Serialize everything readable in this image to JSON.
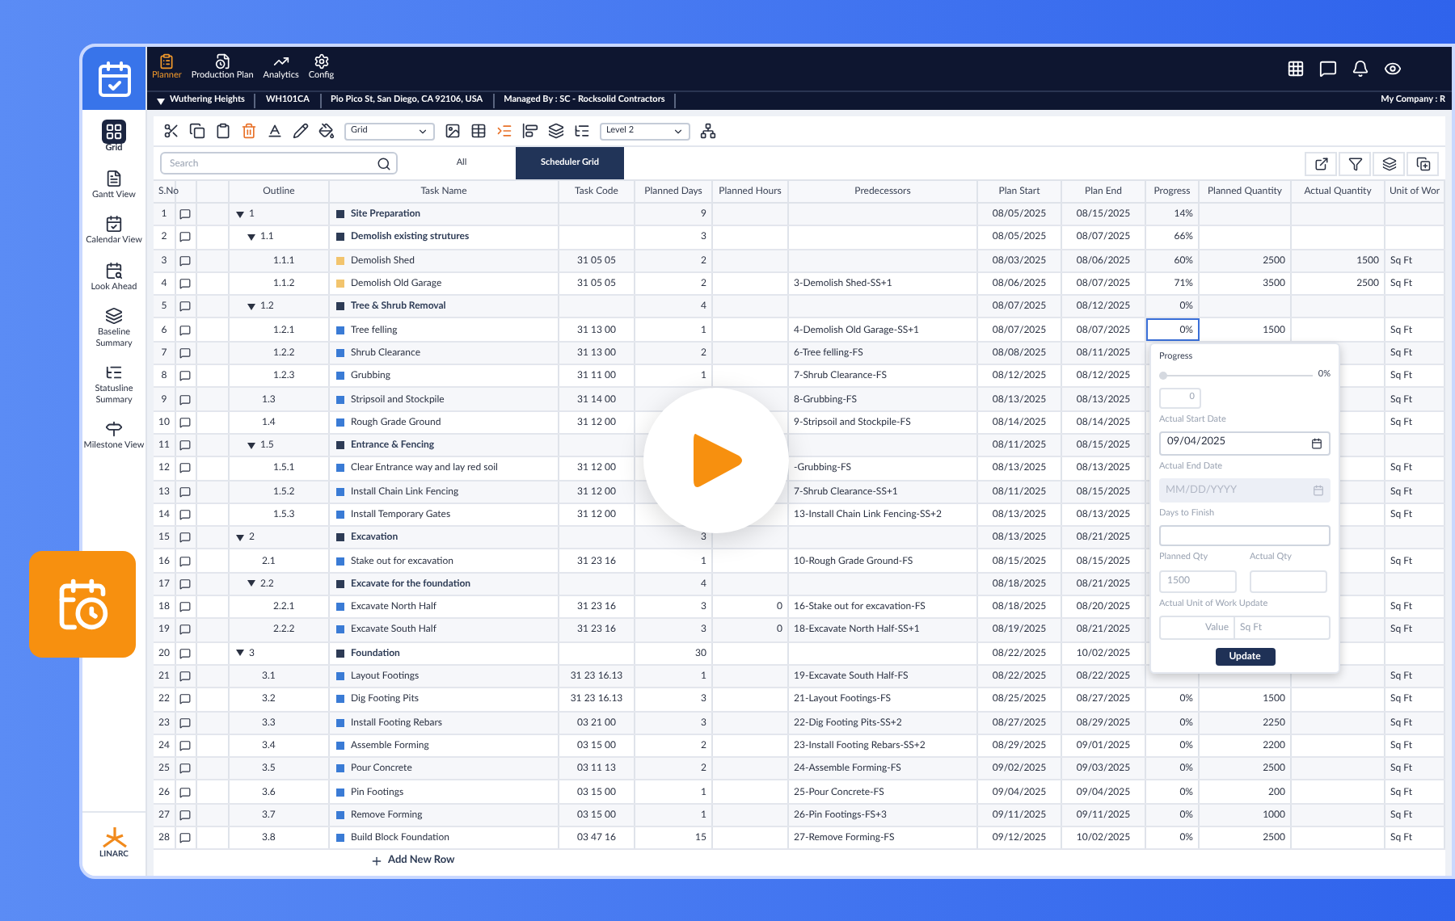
{
  "nav": {
    "tabs": [
      {
        "label": "Planner",
        "selected": true
      },
      {
        "label": "Production Plan",
        "selected": false
      },
      {
        "label": "Analytics",
        "selected": false
      },
      {
        "label": "Config",
        "selected": false
      }
    ]
  },
  "project_bar": {
    "project": "Wuthering Heights",
    "code": "WH101CA",
    "address": "Pio Pico St, San Diego, CA 92106, USA",
    "manager": "Managed By : SC - Rocksolid Contractors",
    "company": "My Company : R"
  },
  "sidebar": {
    "items": [
      {
        "label": "Grid",
        "selected": true
      },
      {
        "label": "Gantt View",
        "selected": false
      },
      {
        "label": "Calendar View",
        "selected": false
      },
      {
        "label": "Look Ahead",
        "selected": false
      },
      {
        "label": "Baseline Summary",
        "selected": false
      },
      {
        "label": "Statusline Summary",
        "selected": false
      },
      {
        "label": "Milestone View",
        "selected": false
      }
    ],
    "logo": "LINARC"
  },
  "toolbar": {
    "view_select": "Grid",
    "level_select": "Level 2"
  },
  "search": {
    "placeholder": "Search"
  },
  "tabs": [
    {
      "label": "All",
      "selected": false
    },
    {
      "label": "Scheduler Grid",
      "selected": true
    }
  ],
  "table": {
    "columns": [
      "S.No",
      "Outline",
      "Task Name",
      "Task Code",
      "Planned Days",
      "Planned Hours",
      "Predecessors",
      "Plan Start",
      "Plan End",
      "Progress",
      "Planned Quantity",
      "Actual Quantity",
      "Unit of Wor"
    ],
    "rows": [
      {
        "sno": "1",
        "outline": "1",
        "name": "Site Preparation",
        "color": "#2d3b55",
        "days": "9",
        "start": "08/05/2025",
        "end": "08/15/2025",
        "progress": "14%",
        "selected": false,
        "expanded": true,
        "children": [
          {
            "sno": "2",
            "outline": "1.1",
            "name": "Demolish existing strutures",
            "color": "#2d3b55",
            "days": "3",
            "start": "08/05/2025",
            "end": "08/07/2025",
            "progress": "66%",
            "selected": false,
            "expanded": true,
            "children": [
              {
                "sno": "3",
                "outline": "1.1.1",
                "name": "Demolish Shed",
                "color": "#f2c46d",
                "code": "31 05 05",
                "days": "2",
                "start": "08/03/2025",
                "end": "08/06/2025",
                "progress": "60%",
                "pqty": "2500",
                "aqty": "1500",
                "unit": "Sq Ft",
                "selected": false
              },
              {
                "sno": "4",
                "outline": "1.1.2",
                "name": "Demolish Old Garage",
                "color": "#f2c46d",
                "code": "31 05 05",
                "days": "2",
                "pred": "3-Demolish Shed-SS+1",
                "start": "08/06/2025",
                "end": "08/07/2025",
                "progress": "71%",
                "pqty": "3500",
                "aqty": "2500",
                "unit": "Sq Ft",
                "selected": false
              }
            ]
          },
          {
            "sno": "5",
            "outline": "1.2",
            "name": "Tree & Shrub Removal",
            "color": "#2d3b55",
            "days": "4",
            "start": "08/07/2025",
            "end": "08/12/2025",
            "progress": "0%",
            "selected": false,
            "expanded": true,
            "children": [
              {
                "sno": "6",
                "outline": "1.2.1",
                "name": "Tree felling",
                "color": "#3a7bd5",
                "code": "31 13 00",
                "days": "1",
                "pred": "4-Demolish Old Garage-SS+1",
                "start": "08/07/2025",
                "end": "08/07/2025",
                "progress": "0%",
                "pqty": "1500",
                "unit": "Sq Ft",
                "selected": true
              },
              {
                "sno": "7",
                "outline": "1.2.2",
                "name": "Shrub Clearance",
                "color": "#3a7bd5",
                "code": "31 13 00",
                "days": "2",
                "pred": "6-Tree felling-FS",
                "start": "08/08/2025",
                "end": "08/11/2025",
                "unit": "Sq Ft",
                "selected": false
              },
              {
                "sno": "8",
                "outline": "1.2.3",
                "name": "Grubbing",
                "color": "#3a7bd5",
                "code": "31 11 00",
                "days": "1",
                "pred": "7-Shrub Clearance-FS",
                "start": "08/12/2025",
                "end": "08/12/2025",
                "unit": "Sq Ft",
                "selected": false
              }
            ]
          },
          {
            "sno": "9",
            "outline": "1.3",
            "name": "Stripsoil and Stockpile",
            "color": "#3a7bd5",
            "code": "31 14 00",
            "pred": "8-Grubbing-FS",
            "start": "08/13/2025",
            "end": "08/13/2025",
            "unit": "Sq Ft",
            "selected": false
          },
          {
            "sno": "10",
            "outline": "1.4",
            "name": "Rough Grade Ground",
            "color": "#3a7bd5",
            "code": "31 12 00",
            "pred": "9-Stripsoil and Stockpile-FS",
            "start": "08/14/2025",
            "end": "08/14/2025",
            "unit": "Sq Ft",
            "selected": false
          },
          {
            "sno": "11",
            "outline": "1.5",
            "name": "Entrance & Fencing",
            "color": "#2d3b55",
            "start": "08/11/2025",
            "end": "08/15/2025",
            "selected": false,
            "expanded": true,
            "children": [
              {
                "sno": "12",
                "outline": "1.5.1",
                "name": "Clear Entrance way and lay red soil",
                "color": "#3a7bd5",
                "code": "31 12 00",
                "pred": "-Grubbing-FS",
                "start": "08/13/2025",
                "end": "08/13/2025",
                "unit": "Sq Ft",
                "selected": false
              },
              {
                "sno": "13",
                "outline": "1.5.2",
                "name": "Install Chain Link Fencing",
                "color": "#3a7bd5",
                "code": "31 12 00",
                "pred": "7-Shrub Clearance-SS+1",
                "start": "08/11/2025",
                "end": "08/15/2025",
                "unit": "Sq Ft",
                "selected": false
              },
              {
                "sno": "14",
                "outline": "1.5.3",
                "name": "Install Temporary Gates",
                "color": "#3a7bd5",
                "code": "31 12 00",
                "pred": "13-Install Chain Link Fencing-SS+2",
                "start": "08/13/2025",
                "end": "08/13/2025",
                "unit": "Sq Ft",
                "selected": false
              }
            ]
          }
        ]
      },
      {
        "sno": "15",
        "outline": "2",
        "name": "Excavation",
        "color": "#2d3b55",
        "days": "3",
        "start": "08/13/2025",
        "end": "08/21/2025",
        "selected": false,
        "expanded": true,
        "children": [
          {
            "sno": "16",
            "outline": "2.1",
            "name": "Stake out for excavation",
            "color": "#3a7bd5",
            "code": "31 23 16",
            "days": "1",
            "pred": "10-Rough Grade Ground-FS",
            "start": "08/15/2025",
            "end": "08/15/2025",
            "unit": "Sq Ft",
            "selected": false
          },
          {
            "sno": "17",
            "outline": "2.2",
            "name": "Excavate for the foundation",
            "color": "#2d3b55",
            "days": "4",
            "start": "08/18/2025",
            "end": "08/21/2025",
            "selected": false,
            "expanded": true,
            "children": [
              {
                "sno": "18",
                "outline": "2.2.1",
                "name": "Excavate North Half",
                "color": "#3a7bd5",
                "code": "31 23 16",
                "days": "3",
                "hours": "0",
                "pred": "16-Stake out for excavation-FS",
                "start": "08/18/2025",
                "end": "08/20/2025",
                "unit": "Sq Ft",
                "selected": false
              },
              {
                "sno": "19",
                "outline": "2.2.2",
                "name": "Excavate South Half",
                "color": "#3a7bd5",
                "code": "31 23 16",
                "days": "3",
                "hours": "0",
                "pred": "18-Excavate North Half-SS+1",
                "start": "08/19/2025",
                "end": "08/21/2025",
                "unit": "Sq Ft",
                "selected": false
              }
            ]
          }
        ]
      },
      {
        "sno": "20",
        "outline": "3",
        "name": "Foundation",
        "color": "#2d3b55",
        "days": "30",
        "start": "08/22/2025",
        "end": "10/02/2025",
        "selected": false,
        "expanded": true,
        "children": [
          {
            "sno": "21",
            "outline": "3.1",
            "name": "Layout Footings",
            "color": "#3a7bd5",
            "code": "31 23 16.13",
            "days": "1",
            "pred": "19-Excavate South Half-FS",
            "start": "08/22/2025",
            "end": "08/22/2025",
            "unit": "Sq Ft",
            "selected": false
          },
          {
            "sno": "22",
            "outline": "3.2",
            "name": "Dig Footing Pits",
            "color": "#3a7bd5",
            "code": "31 23 16.13",
            "days": "3",
            "pred": "21-Layout Footings-FS",
            "start": "08/25/2025",
            "end": "08/27/2025",
            "progress": "0%",
            "pqty": "1500",
            "unit": "Sq Ft",
            "selected": false
          },
          {
            "sno": "23",
            "outline": "3.3",
            "name": "Install Footing Rebars",
            "color": "#3a7bd5",
            "code": "03 21 00",
            "days": "3",
            "pred": "22-Dig Footing Pits-SS+2",
            "start": "08/27/2025",
            "end": "08/29/2025",
            "progress": "0%",
            "pqty": "2250",
            "unit": "Sq Ft",
            "selected": false
          },
          {
            "sno": "24",
            "outline": "3.4",
            "name": "Assemble Forming",
            "color": "#3a7bd5",
            "code": "03 15 00",
            "days": "2",
            "pred": "23-Install Footing Rebars-SS+2",
            "start": "08/29/2025",
            "end": "09/01/2025",
            "progress": "0%",
            "pqty": "2200",
            "unit": "Sq Ft",
            "selected": false
          },
          {
            "sno": "25",
            "outline": "3.5",
            "name": "Pour Concrete",
            "color": "#3a7bd5",
            "code": "03 11 13",
            "days": "2",
            "pred": "24-Assemble Forming-FS",
            "start": "09/02/2025",
            "end": "09/03/2025",
            "progress": "0%",
            "pqty": "2500",
            "unit": "Sq Ft",
            "selected": false
          },
          {
            "sno": "26",
            "outline": "3.6",
            "name": "Pin Footings",
            "color": "#3a7bd5",
            "code": "03 15 00",
            "days": "1",
            "pred": "25-Pour Concrete-FS",
            "start": "09/04/2025",
            "end": "09/04/2025",
            "progress": "0%",
            "pqty": "200",
            "unit": "Sq Ft",
            "selected": false
          },
          {
            "sno": "27",
            "outline": "3.7",
            "name": "Remove Forming",
            "color": "#3a7bd5",
            "code": "03 15 00",
            "days": "1",
            "pred": "26-Pin Footings-FS+3",
            "start": "09/11/2025",
            "end": "09/11/2025",
            "progress": "0%",
            "pqty": "1000",
            "unit": "Sq Ft",
            "selected": false
          },
          {
            "sno": "28",
            "outline": "3.8",
            "name": "Build Block Foundation",
            "color": "#3a7bd5",
            "code": "03 47 16",
            "days": "15",
            "pred": "27-Remove Forming-FS",
            "start": "09/12/2025",
            "end": "10/02/2025",
            "progress": "0%",
            "pqty": "2500",
            "unit": "Sq Ft",
            "selected": false
          }
        ]
      }
    ],
    "add_row": "Add New Row"
  },
  "progress_popup": {
    "title": "Progress",
    "level": 0,
    "reading": "0%",
    "value": "0",
    "start_label": "Actual Start Date",
    "start_value": "09/04/2025",
    "end_label": "Actual End Date",
    "end_placeholder": "MM/DD/YYYY",
    "days_label": "Days to Finish",
    "planned_label": "Planned Qty",
    "planned_value": "1500",
    "actual_label": "Actual Qty",
    "unit_label": "Actual Unit of Work Update",
    "unit_placeholder": "Value",
    "unit_value": "Sq Ft",
    "button": "Update"
  }
}
